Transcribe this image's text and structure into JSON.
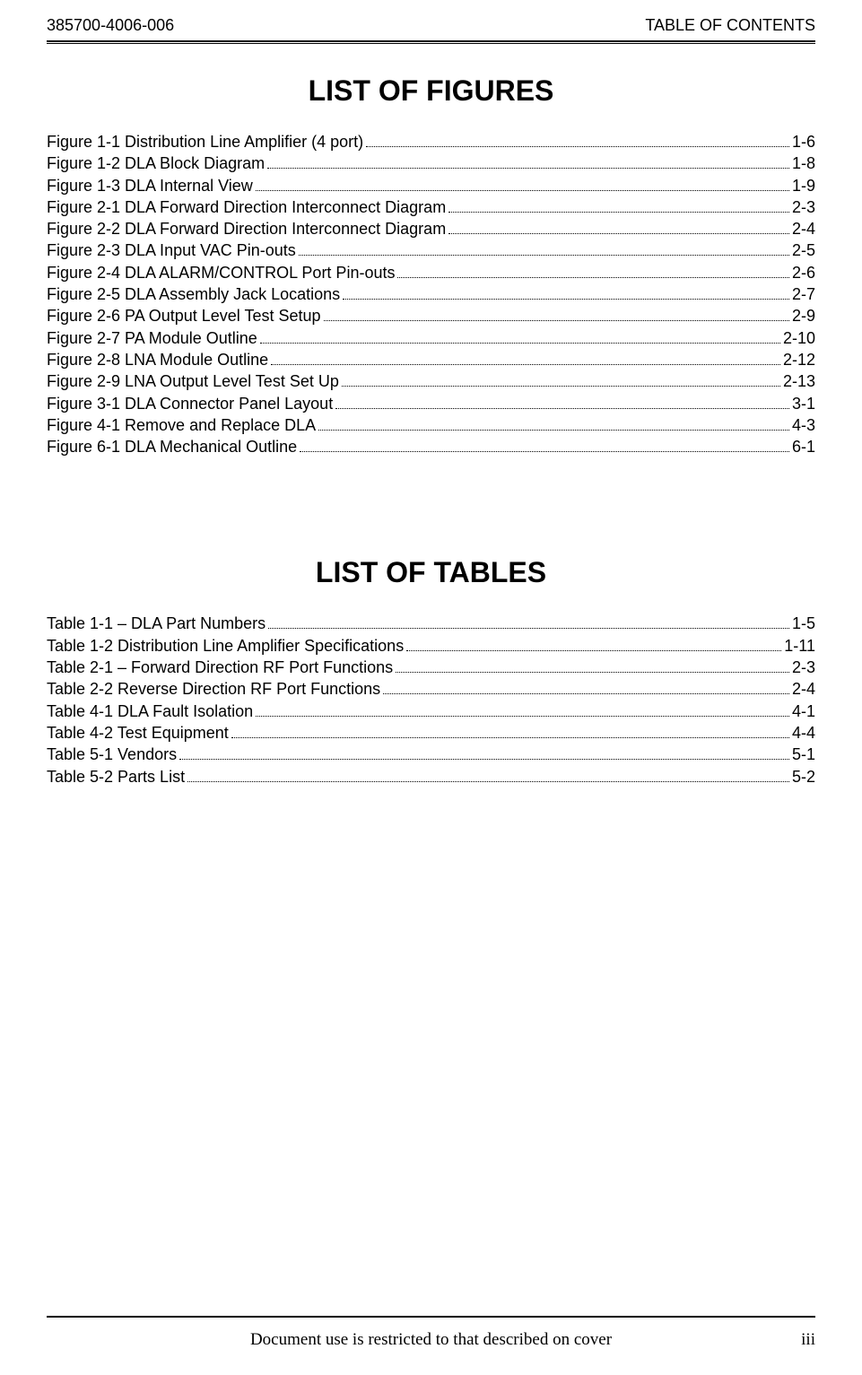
{
  "header": {
    "left": "385700-4006-006",
    "right": "TABLE OF CONTENTS"
  },
  "figures": {
    "title": "LIST OF FIGURES",
    "items": [
      {
        "label": "Figure 1-1  Distribution Line Amplifier (4 port)",
        "page": "1-6"
      },
      {
        "label": "Figure 1-2  DLA Block Diagram ",
        "page": "1-8"
      },
      {
        "label": "Figure 1-3 DLA Internal View ",
        "page": "1-9"
      },
      {
        "label": "Figure 2-1  DLA Forward Direction Interconnect Diagram",
        "page": "2-3"
      },
      {
        "label": "Figure 2-2 DLA Forward Direction Interconnect Diagram",
        "page": "2-4"
      },
      {
        "label": "Figure 2-3 DLA Input VAC Pin-outs ",
        "page": "2-5"
      },
      {
        "label": "Figure 2-4  DLA ALARM/CONTROL Port Pin-outs",
        "page": "2-6"
      },
      {
        "label": "Figure 2-5  DLA Assembly Jack Locations",
        "page": "2-7"
      },
      {
        "label": "Figure 2-6  PA Output Level Test Setup ",
        "page": "2-9"
      },
      {
        "label": "Figure 2-7  PA Module Outline",
        "page": "2-10"
      },
      {
        "label": "Figure 2-8  LNA Module Outline",
        "page": "2-12"
      },
      {
        "label": "Figure 2-9  LNA Output Level Test Set Up",
        "page": "2-13"
      },
      {
        "label": "Figure 3-1  DLA Connector Panel Layout",
        "page": "3-1"
      },
      {
        "label": "Figure 4-1  Remove and Replace DLA",
        "page": "4-3"
      },
      {
        "label": "Figure 6-1  DLA Mechanical Outline ",
        "page": "6-1"
      }
    ]
  },
  "tables": {
    "title": "LIST OF TABLES",
    "items": [
      {
        "label": "Table 1-1 – DLA Part Numbers",
        "page": "1-5"
      },
      {
        "label": "Table 1-2  Distribution Line Amplifier Specifications",
        "page": "1-11"
      },
      {
        "label": "Table 2-1 – Forward Direction RF Port Functions ",
        "page": "2-3"
      },
      {
        "label": "Table 2-2 Reverse Direction RF Port Functions",
        "page": "2-4"
      },
      {
        "label": "Table 4-1  DLA Fault Isolation",
        "page": "4-1"
      },
      {
        "label": "Table 4-2  Test Equipment",
        "page": "4-4"
      },
      {
        "label": "Table 5-1  Vendors ",
        "page": "5-1"
      },
      {
        "label": "Table 5-2  Parts List",
        "page": "5-2"
      }
    ]
  },
  "footer": {
    "center": "Document use is restricted to that described on cover",
    "right": "iii"
  }
}
